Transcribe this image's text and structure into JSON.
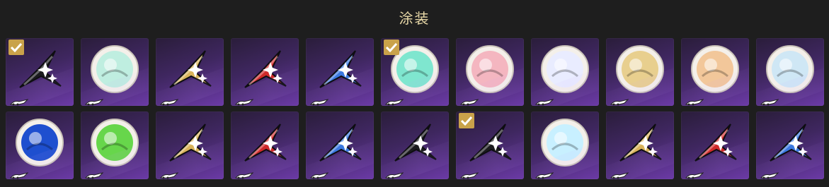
{
  "header": {
    "title": "涂装"
  },
  "colors": {
    "checkmark": "#c9a24a",
    "card_bottom": "#6b3aa6",
    "card_top": "#2a1d3a"
  },
  "rows": [
    [
      {
        "kind": "star",
        "color": "#1b1b1e",
        "selected": true,
        "name": "black-star-skin"
      },
      {
        "kind": "disc",
        "color": "#bfeee0",
        "selected": false,
        "name": "iridescent-disc-skin"
      },
      {
        "kind": "star",
        "color": "#d9b35a",
        "selected": false,
        "name": "gold-star-skin"
      },
      {
        "kind": "star",
        "color": "#d02a2a",
        "selected": false,
        "name": "red-star-skin"
      },
      {
        "kind": "star",
        "color": "#3a78e0",
        "selected": false,
        "name": "blue-star-skin"
      },
      {
        "kind": "disc",
        "color": "#7fe6cf",
        "selected": true,
        "name": "galaxy-disc-skin"
      },
      {
        "kind": "disc",
        "color": "#f4b6c0",
        "selected": false,
        "name": "pink-portrait-disc-skin"
      },
      {
        "kind": "disc",
        "color": "#e9ecff",
        "selected": false,
        "name": "blue-mask-disc-skin"
      },
      {
        "kind": "disc",
        "color": "#e8cf8e",
        "selected": false,
        "name": "gold-emblem-disc-skin"
      },
      {
        "kind": "disc",
        "color": "#f2c79a",
        "selected": false,
        "name": "cyan-crest-disc-skin"
      },
      {
        "kind": "disc",
        "color": "#cfe7f5",
        "selected": false,
        "name": "blonde-character-disc-skin"
      }
    ],
    [
      {
        "kind": "disc",
        "color": "#1e4fcf",
        "selected": false,
        "name": "blue-hair-character-skin"
      },
      {
        "kind": "disc",
        "color": "#67d64b",
        "selected": false,
        "name": "green-creature-disc-skin"
      },
      {
        "kind": "star",
        "color": "#d9b35a",
        "selected": false,
        "name": "gold-star-skin"
      },
      {
        "kind": "star",
        "color": "#d02a2a",
        "selected": false,
        "name": "red-star-skin"
      },
      {
        "kind": "star",
        "color": "#3a78e0",
        "selected": false,
        "name": "blue-star-skin"
      },
      {
        "kind": "star",
        "color": "#1b1b1e",
        "selected": false,
        "name": "black-star-skin"
      },
      {
        "kind": "star",
        "color": "#1b1b1e",
        "selected": true,
        "name": "black-star-skin"
      },
      {
        "kind": "disc",
        "color": "#c8f0ff",
        "selected": false,
        "name": "cat-face-disc-skin"
      },
      {
        "kind": "star",
        "color": "#d9b35a",
        "selected": false,
        "name": "gold-star-skin"
      },
      {
        "kind": "star",
        "color": "#d02a2a",
        "selected": false,
        "name": "red-star-skin"
      },
      {
        "kind": "star",
        "color": "#3a78e0",
        "selected": false,
        "name": "blue-star-skin"
      }
    ]
  ]
}
